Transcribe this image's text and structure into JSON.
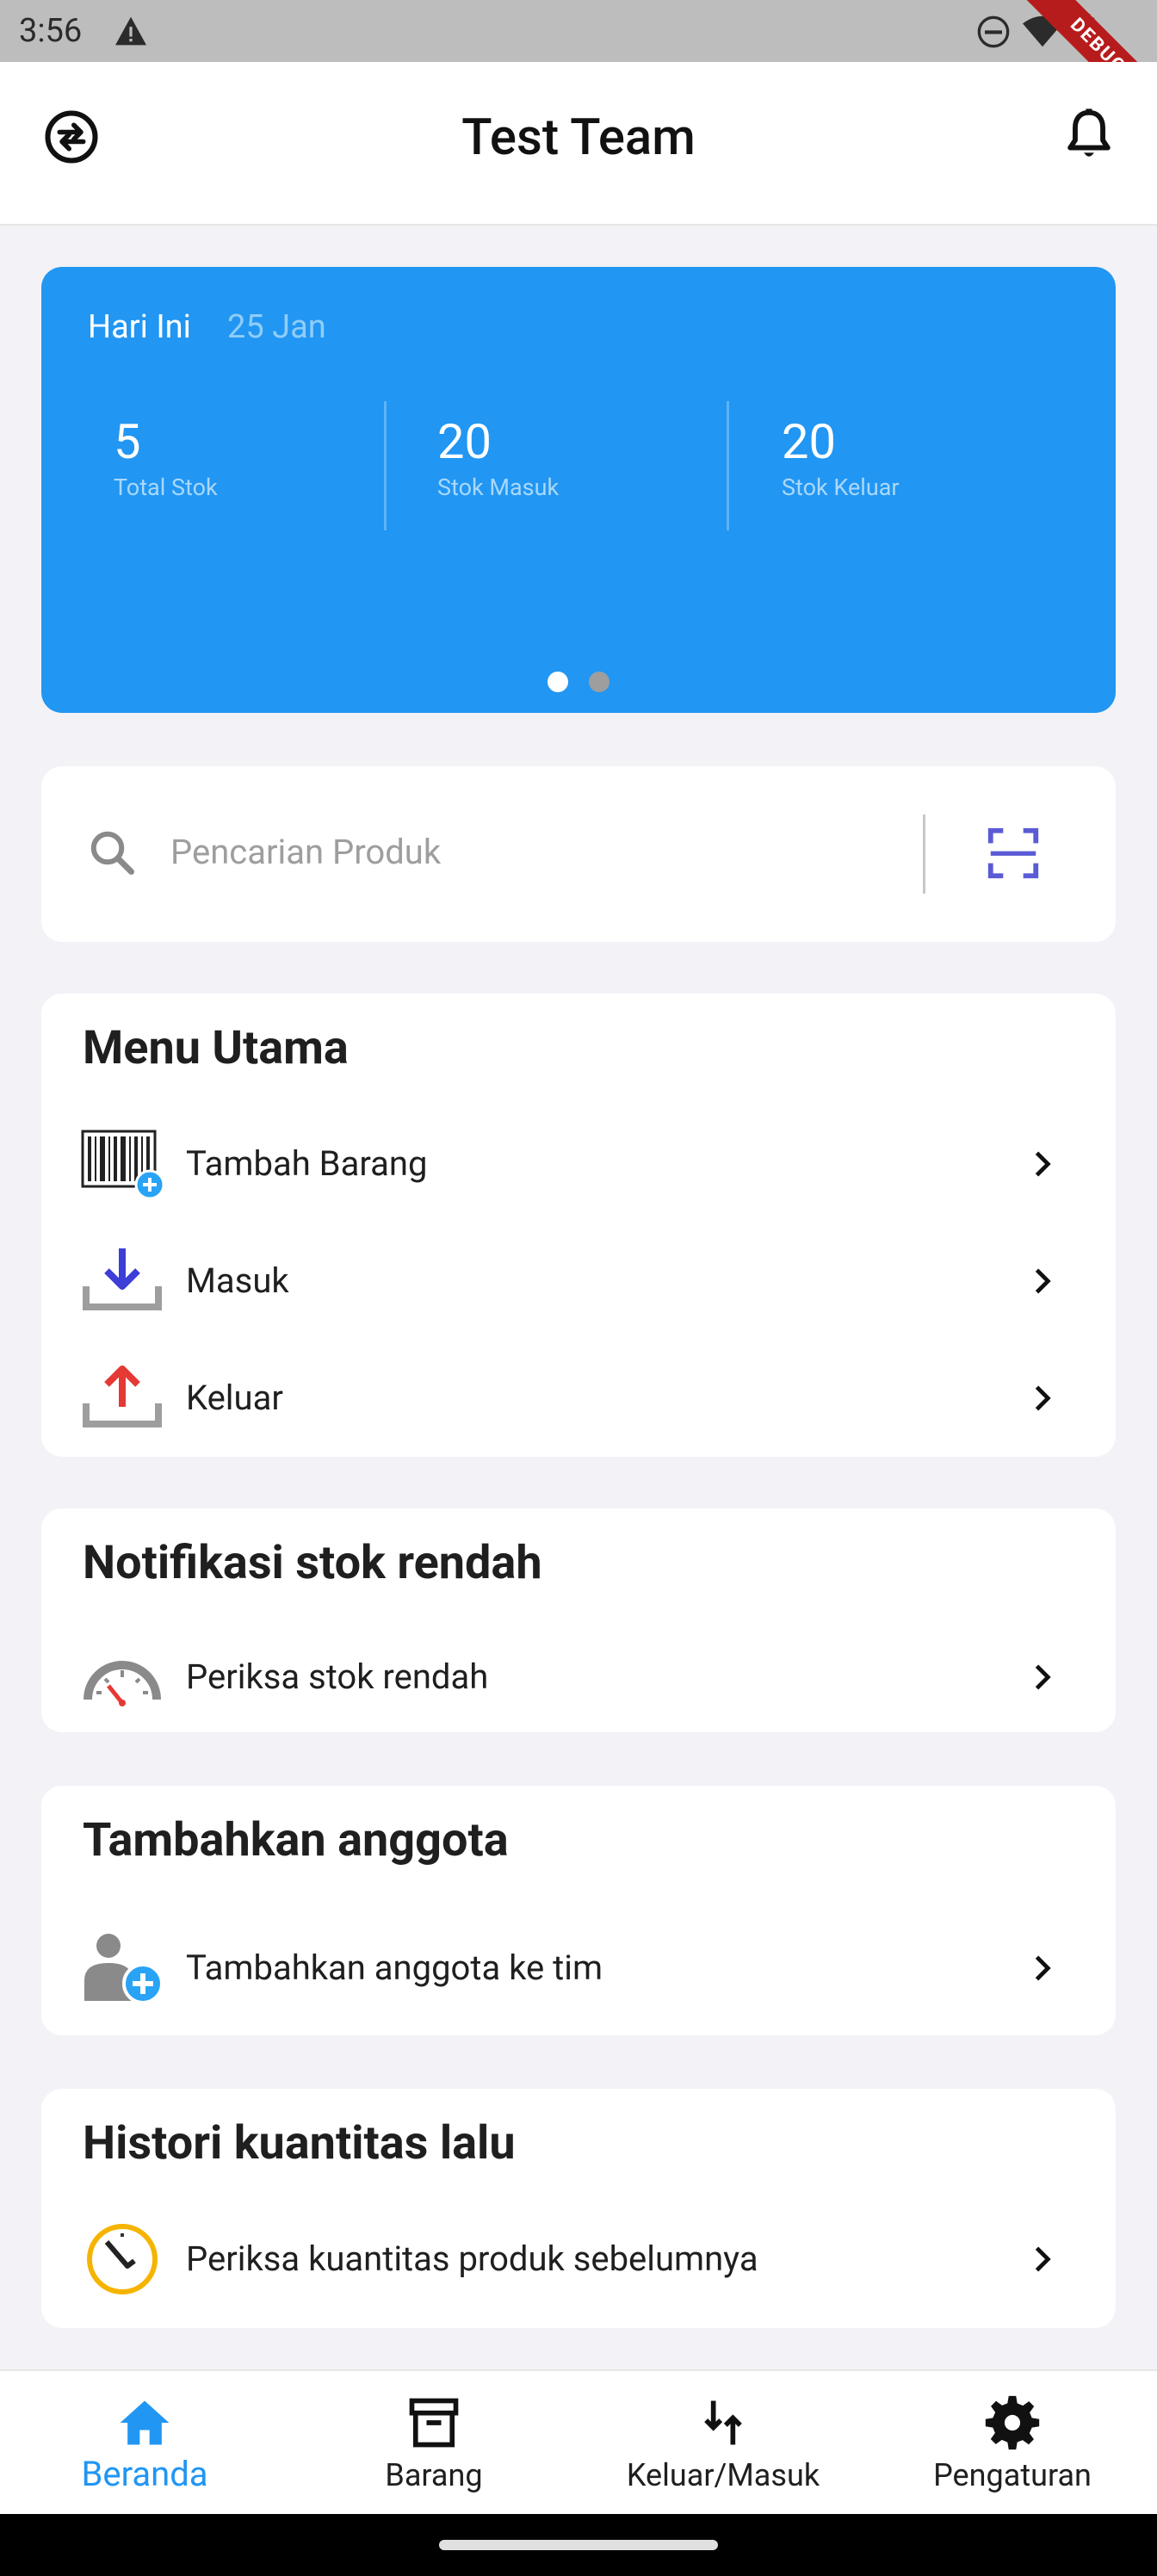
{
  "status_bar": {
    "time": "3:56",
    "debug_label": "DEBUG"
  },
  "app_bar": {
    "title": "Test Team"
  },
  "summary": {
    "day_label": "Hari Ini",
    "date": "25 Jan",
    "stats": [
      {
        "value": "5",
        "label": "Total Stok"
      },
      {
        "value": "20",
        "label": "Stok Masuk"
      },
      {
        "value": "20",
        "label": "Stok Keluar"
      }
    ],
    "page_count": 2,
    "active_page": 1
  },
  "search": {
    "placeholder": "Pencarian Produk"
  },
  "main_menu": {
    "title": "Menu Utama",
    "items": [
      {
        "label": "Tambah Barang",
        "icon": "barcode-add-icon"
      },
      {
        "label": "Masuk",
        "icon": "download-tray-icon"
      },
      {
        "label": "Keluar",
        "icon": "upload-tray-icon"
      }
    ]
  },
  "low_stock": {
    "title": "Notifikasi stok rendah",
    "item": {
      "label": "Periksa stok rendah",
      "icon": "gauge-icon"
    }
  },
  "add_member": {
    "title": "Tambahkan anggota",
    "item": {
      "label": "Tambahkan anggota ke tim",
      "icon": "add-person-icon"
    }
  },
  "history": {
    "title": "Histori kuantitas lalu",
    "item": {
      "label": "Periksa kuantitas produk sebelumnya",
      "icon": "clock-icon"
    }
  },
  "bottom_nav": [
    {
      "label": "Beranda",
      "icon": "home-icon",
      "active": true
    },
    {
      "label": "Barang",
      "icon": "archive-box-icon",
      "active": false
    },
    {
      "label": "Keluar/Masuk",
      "icon": "swap-vertical-icon",
      "active": false
    },
    {
      "label": "Pengaturan",
      "icon": "gear-icon",
      "active": false
    }
  ],
  "colors": {
    "primary": "#2196f3",
    "scan": "#5b5bd6",
    "in_arrow": "#3d3dd8",
    "out_arrow": "#e53935"
  }
}
